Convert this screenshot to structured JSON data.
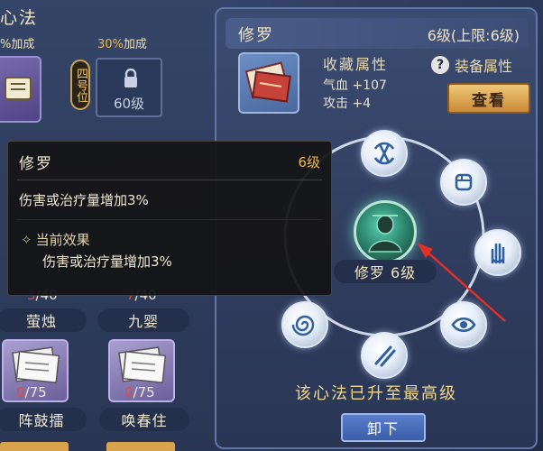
{
  "left_panel": {
    "title": "心法",
    "bonus_left": "%加成",
    "bonus_right_pct": "30%",
    "bonus_right_text": "加成",
    "slot_badge": "4",
    "pos_tag": "四号位",
    "locked_level": "60级",
    "row1": [
      {
        "count_red": "3",
        "count_rest": "/40",
        "name": "萤烛"
      },
      {
        "count_red": "7",
        "count_rest": "/40",
        "name": "九婴"
      }
    ],
    "row2": [
      {
        "count_red": "0",
        "count_rest": "/75",
        "name": "阵鼓擂"
      },
      {
        "count_red": "0",
        "count_rest": "/75",
        "name": "唤春住"
      }
    ]
  },
  "right_panel": {
    "name": "修罗",
    "level": "6级(上限:6级)",
    "collect_title": "收藏属性",
    "attr_hp": "气血 +107",
    "attr_atk": "攻击 +4",
    "help": "?",
    "equip_label": "装备属性",
    "view_button": "查看",
    "center_label": "修罗 6级",
    "max_message": "该心法已升至最高级",
    "unload_button": "卸下"
  },
  "tooltip": {
    "name": "修罗",
    "level": "6级",
    "desc": "伤害或治疗量增加3%",
    "effect_head": "当前效果",
    "effect_body": "伤害或治疗量增加3%"
  },
  "icons": [
    "lock-icon",
    "scroll-icon",
    "book-icon",
    "hand-icon",
    "eye-icon",
    "arrow-icon",
    "swirl-icon",
    "knot-icon",
    "fist-icon"
  ],
  "colors": {
    "accent_gold": "#f0b84c",
    "count_red": "#e24b3c",
    "annotation_red": "#e0302a"
  }
}
